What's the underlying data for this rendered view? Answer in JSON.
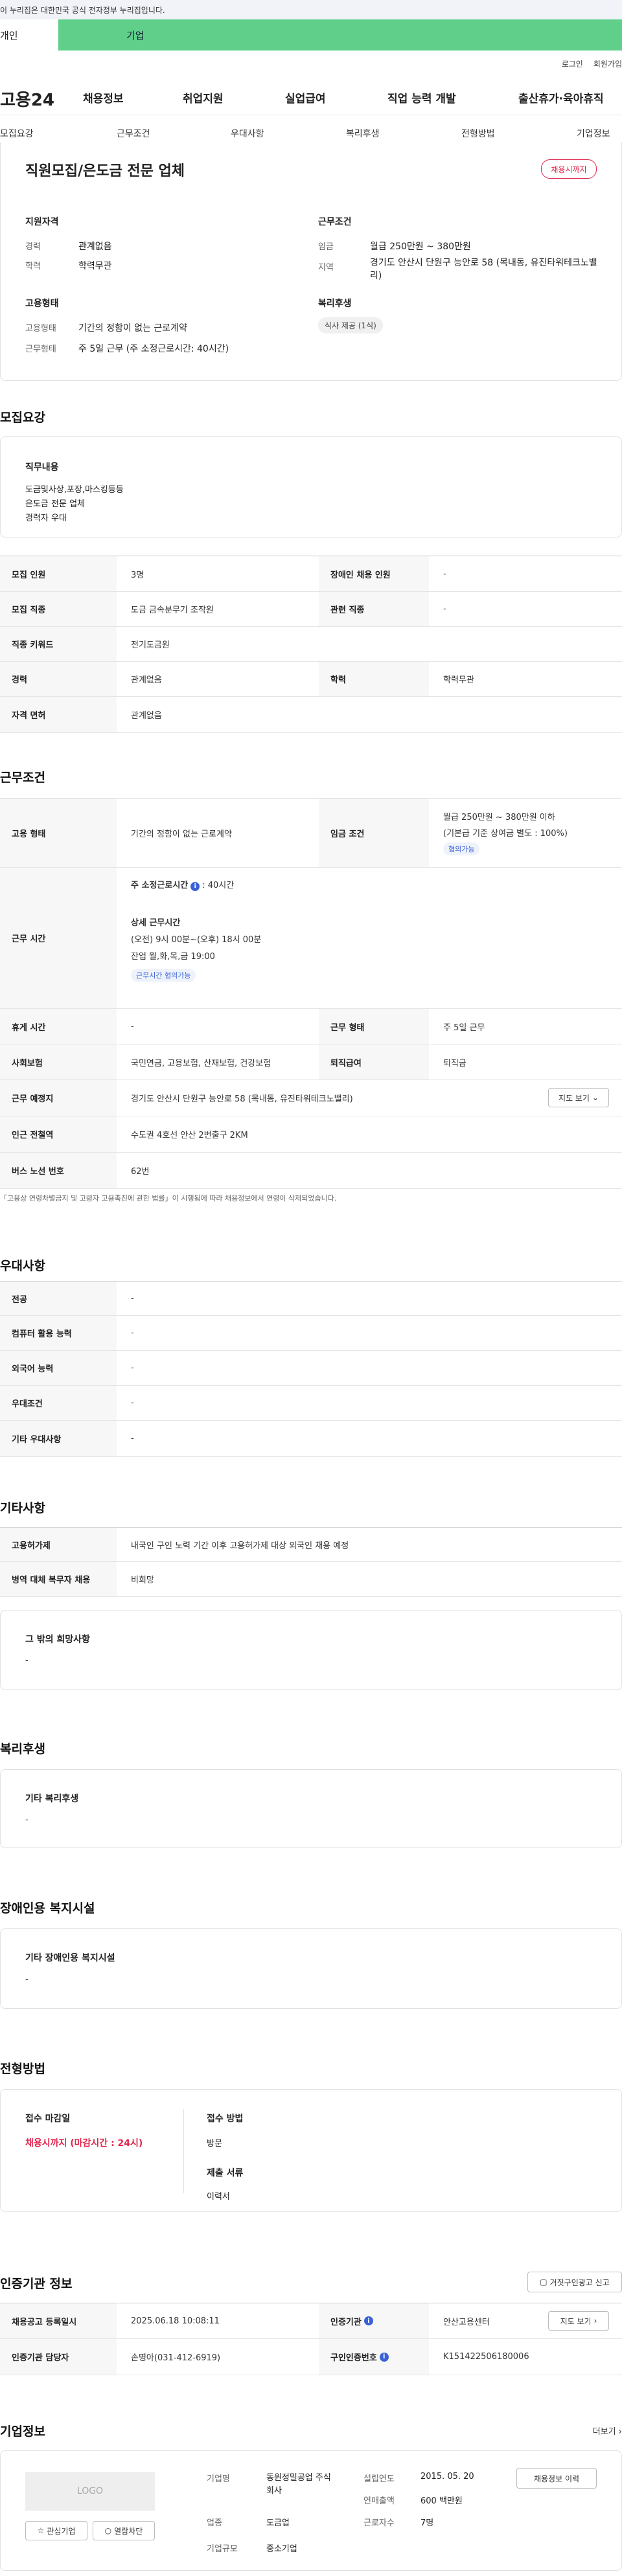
{
  "gov_notice": "이 누리집은 대한민국 공식 전자정부 누리집입니다.",
  "top_tabs": {
    "individual": "개인",
    "corporate": "기업"
  },
  "util": {
    "login": "로그인",
    "join": "회원가입"
  },
  "brand": "고용24",
  "gnb": [
    "채용정보",
    "취업지원",
    "실업급여",
    "직업 능력 개발",
    "출산휴가·육아휴직"
  ],
  "subnav": [
    "모집요강",
    "근무조건",
    "우대사항",
    "복리후생",
    "전형방법",
    "기업정보"
  ],
  "summary": {
    "company_title": "직원모집/은도금 전문 업체",
    "badge": "채용시까지",
    "qual_heading": "지원자격",
    "career_label": "경력",
    "career_value": "관계없음",
    "edu_label": "학력",
    "edu_value": "학력무관",
    "cond_heading": "근무조건",
    "wage_label": "임금",
    "wage_value": "월급 250만원 ~ 380만원",
    "region_label": "지역",
    "region_value": "경기도 안산시 단원구 능안로 58 (목내동, 유진타워테크노밸리)",
    "emp_heading": "고용형태",
    "emp_type_label": "고용형태",
    "emp_type_value": "기간의 정함이 없는 근로계약",
    "work_type_label": "근무형태",
    "work_type_value": "주 5일 근무 (주 소정근로시간: 40시간)",
    "welfare_heading": "복리후생",
    "welfare_chip": "식사 제공 (1식)"
  },
  "recruit": {
    "title": "모집요강",
    "duty_label": "직무내용",
    "duty_lines": [
      "도금및사상,포장,마스킹등등",
      "은도금 전문 업체",
      "경력자 우대"
    ],
    "headcount_label": "모집 인원",
    "headcount_value": "3명",
    "disabled_label": "장애인 채용 인원",
    "disabled_value": "-",
    "job_label": "모집 직종",
    "job_value": "도금 금속분무기 조작원",
    "related_label": "관련 직종",
    "related_value": "-",
    "keyword_label": "직종 키워드",
    "keyword_value": "전기도금원",
    "career_label": "경력",
    "career_value": "관계없음",
    "edu_label": "학력",
    "edu_value": "학력무관",
    "license_label": "자격 면허",
    "license_value": "관계없음"
  },
  "work": {
    "title": "근무조건",
    "emp_label": "고용 형태",
    "emp_value": "기간의 정함이 없는 근로계약",
    "wage_label": "임금 조건",
    "wage_value": "월급 250만원 ~ 380만원 이하",
    "wage_note": "(기본급 기준 상여금 별도 : 100%)",
    "wage_pill": "협의가능",
    "hours_label": "근무 시간",
    "hours_week": "주 소정근로시간",
    "hours_week_val": ": 40시간",
    "hours_detail_title": "상세 근무시간",
    "hours_detail_1": "(오전) 9시 00분~(오후) 18시 00분",
    "hours_detail_2": "잔업 월,화,목,금 19:00",
    "hours_pill": "근무시간 협의가능",
    "rest_label": "휴게 시간",
    "rest_value": "-",
    "shift_label": "근무 형태",
    "shift_value": "주 5일 근무",
    "insurance_label": "사회보험",
    "insurance_value": "국민연금, 고용보험, 산재보험, 건강보험",
    "severance_label": "퇴직급여",
    "severance_value": "퇴직금",
    "place_label": "근무 예정지",
    "place_value": "경기도 안산시 단원구 능안로 58 (목내동, 유진타워테크노밸리)",
    "map_btn": "지도 보기",
    "subway_label": "인근 전철역",
    "subway_value": "수도권 4호선 안산 2번출구 2KM",
    "bus_label": "버스 노선 번호",
    "bus_value": "62번",
    "footnote": "「고용상 연령차별금지 및 고령자 고용촉진에 관한 법률」이 시행됨에 따라 채용정보에서 연령이 삭제되었습니다."
  },
  "pref": {
    "title": "우대사항",
    "rows": [
      {
        "label": "전공",
        "value": "-"
      },
      {
        "label": "컴퓨터 활용 능력",
        "value": "-"
      },
      {
        "label": "외국어 능력",
        "value": "-"
      },
      {
        "label": "우대조건",
        "value": "-"
      },
      {
        "label": "기타 우대사항",
        "value": "-"
      }
    ]
  },
  "etc": {
    "title": "기타사항",
    "foreign_label": "고용허가제",
    "foreign_value": "내국인 구인 노력 기간 이후 고용허가제 대상 외국인 채용 예정",
    "military_label": "병역 대체 복무자 채용",
    "military_value": "비희망",
    "other_label": "그 밖의 희망사항",
    "other_value": "-"
  },
  "welfare": {
    "title": "복리후생",
    "label": "기타 복리후생",
    "value": "-"
  },
  "disability": {
    "title": "장애인용 복지시설",
    "label": "기타 장애인용 복지시설",
    "value": "-"
  },
  "selection": {
    "title": "전형방법",
    "deadline_label": "접수 마감일",
    "deadline_value": "채용시까지 (마감시간 : 24시)",
    "method_label": "접수 방법",
    "method_value": "방문",
    "docs_label": "제출 서류",
    "docs_value": "이력서"
  },
  "cert": {
    "title": "인증기관 정보",
    "report_btn": "거짓구인광고 신고",
    "reg_date_label": "채용공고 등록일시",
    "reg_date_value": "2025.06.18 10:08:11",
    "agency_label": "인증기관",
    "agency_value": "안산고용센터",
    "agency_map_btn": "지도 보기",
    "manager_label": "인증기관 담당자",
    "manager_value": "손명아(031-412-6919)",
    "cert_no_label": "구인인증번호",
    "cert_no_value": "K151422506180006"
  },
  "company": {
    "title": "기업정보",
    "more": "더보기",
    "logo": "LOGO",
    "fav_btn": "관심기업",
    "block_btn": "열람차단",
    "name_label": "기업명",
    "name_value": "동원정밀공업 주식회사",
    "industry_label": "업종",
    "industry_value": "도금업",
    "size_label": "기업규모",
    "size_value": "중소기업",
    "founded_label": "설립연도",
    "founded_value": "2015. 05. 20",
    "revenue_label": "연매출액",
    "revenue_value": "600 백만원",
    "employees_label": "근로자수",
    "employees_value": "7명",
    "history_btn": "채용정보 이력"
  },
  "colors": {
    "accent_green": "#5fcf8a",
    "accent_red": "#e0264d",
    "accent_blue": "#3a61d6"
  }
}
